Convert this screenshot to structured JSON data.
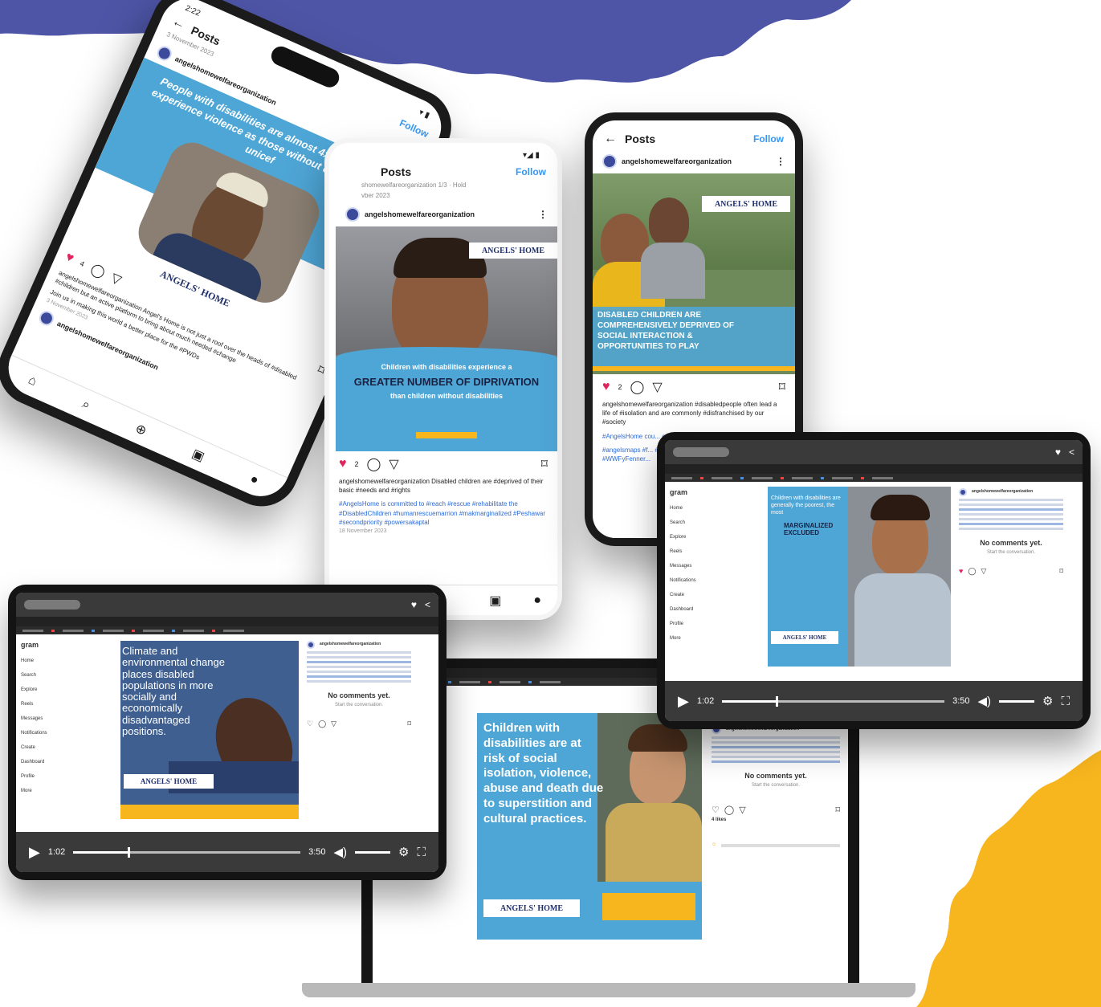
{
  "colors": {
    "ig_blue": "#3797f0",
    "panel_blue": "#4ea6d6",
    "brand_navy": "#3b4a9a",
    "accent_yellow": "#f7b51e",
    "heart_red": "#e0245e"
  },
  "brand": {
    "logo": "ANGELS' HOME",
    "account": "angelshomewelfareorganization"
  },
  "phone1": {
    "status_time": "2:22",
    "title": "Posts",
    "follow": "Follow",
    "date_top": "3 November 2023",
    "account": "angelshomewelfareorganization",
    "headline": "People with disabilities are almost 4x as likely to experience violence as those without disabilities - unicef",
    "likes": "4",
    "caption": "angelshomewelfareorganization Angel's Home is not just a roof over the heads of #disabled #children but an active platform to bring about much needed #change",
    "caption2": "Join us in making this world a better place for the #PWDs",
    "date_bottom": "3 November 2023",
    "account2": "angelshomewelfareorganization"
  },
  "phone2": {
    "status": "▾◢ ▮",
    "title": "Posts",
    "follow": "Follow",
    "subacct": "shomewelfareorganization 1/3 · Hold",
    "date_top": "vber 2023",
    "account": "angelshomewelfareorganization",
    "banner_small": "Children with disabilities experience a",
    "banner_big": "GREATER NUMBER OF DIPRIVATION",
    "banner_sub": "than children without disabilities",
    "likes": "2",
    "caption": "angelshomewelfareorganization Disabled children are #deprived of their basic #needs and #rights",
    "caption2": "#AngelsHome is committed to #reach #rescue #rehabilitate the #DisabledChildren #humanrescuemarrion #makmarginalized #Peshawar #secondpriority #powersakaptal",
    "date_bottom": "18 November 2023"
  },
  "phone3": {
    "title": "Posts",
    "follow": "Follow",
    "account": "angelshomewelfareorganization",
    "banner": "DISABLED CHILDREN ARE COMPREHENSIVELY DEPRIVED OF SOCIAL INTERACTION & OPPORTUNITIES TO PLAY",
    "likes": "2",
    "caption": "angelshomewelfareorganization #disabledpeople often lead a life of #isolation and are commonly #disfranchised by our #society",
    "caption2": "#AngelsHome cou... opportunities fo... and #play which",
    "caption3": "#angelsmaps #f... #disasterlsbetw... #FocusOfTheFo... #WWFyFenner..."
  },
  "tablet1": {
    "title_pill": "",
    "post_text": "Climate and environmental change places disabled populations in more socially and economically disadvantaged positions.",
    "time_cur": "1:02",
    "time_total": "3:50",
    "no_comments": "No comments yet.",
    "start_conv": "Start the conversation.",
    "sidebar": [
      "Home",
      "Search",
      "Explore",
      "Reels",
      "Messages",
      "Notifications",
      "Create",
      "Dashboard",
      "Profile",
      "More"
    ],
    "side_head": "gram"
  },
  "tablet2": {
    "post_text1": "Children with disabilities are generally the poorest, the most",
    "post_text_bold": "MARGINALIZED EXCLUDED",
    "post_text2": "",
    "time_cur": "1:02",
    "time_total": "3:50",
    "no_comments": "No comments yet.",
    "start_conv": "Start the conversation.",
    "sidebar": [
      "Home",
      "Search",
      "Explore",
      "Reels",
      "Messages",
      "Notifications",
      "Create",
      "Dashboard",
      "Profile",
      "More"
    ],
    "side_head": "gram"
  },
  "laptop": {
    "post_text": "Children with disabilities are at risk of social isolation, violence, abuse and death due to superstition and cultural practices.",
    "no_comments": "No comments yet.",
    "start_conv": "Start the conversation.",
    "likes_label": "4 likes"
  }
}
